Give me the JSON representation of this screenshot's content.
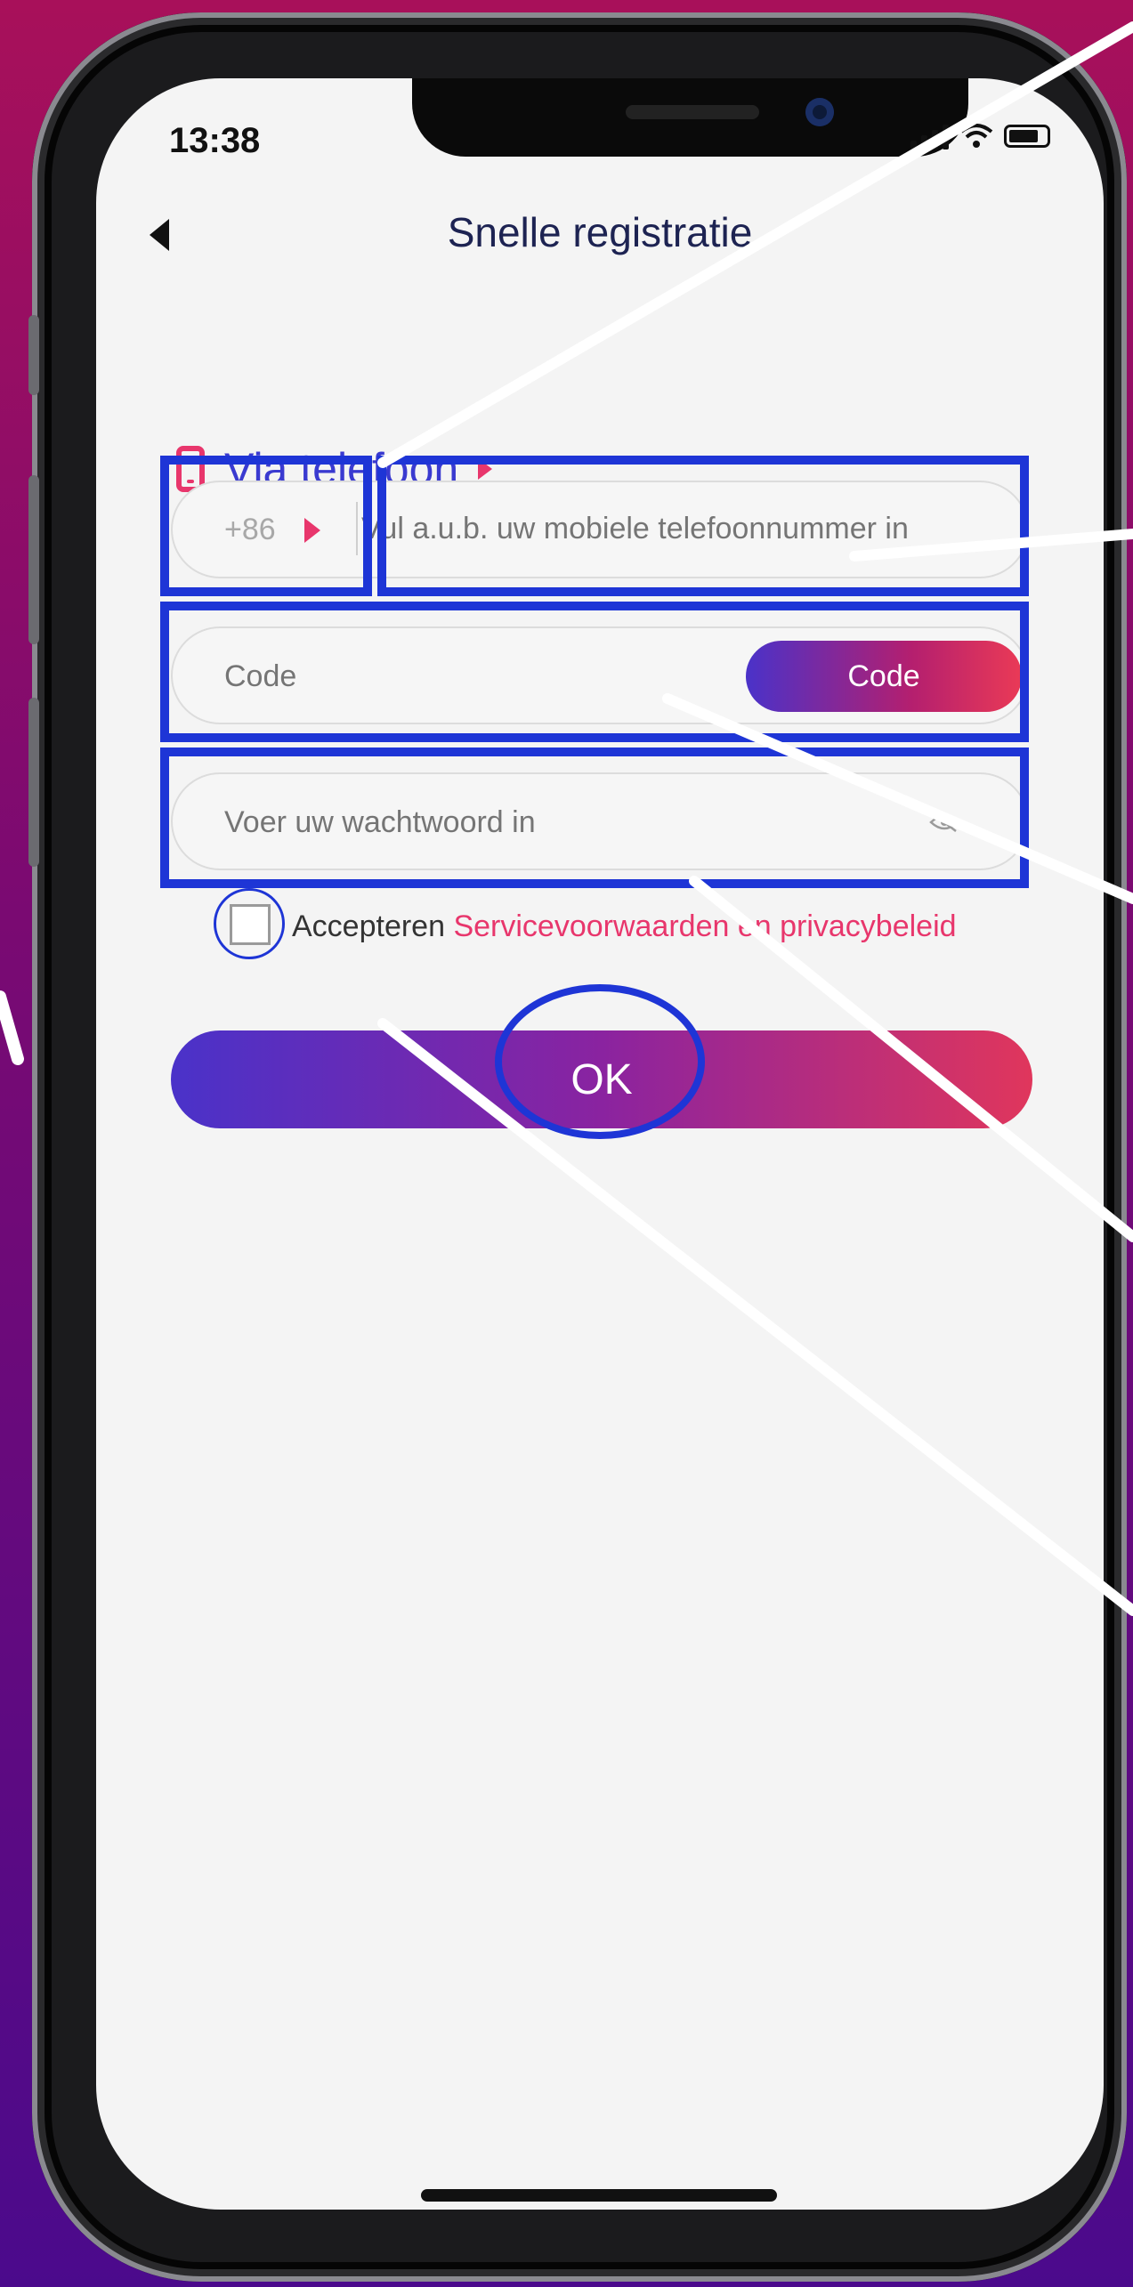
{
  "status_bar": {
    "time": "13:38"
  },
  "header": {
    "title": "Snelle registratie",
    "back_icon": "back-arrow-icon"
  },
  "section": {
    "label": "Via telefoon",
    "icon": "phone-icon"
  },
  "form": {
    "country_code": "+86",
    "phone_placeholder": "Vul a.u.b. uw mobiele telefoonnummer in",
    "code_placeholder": "Code",
    "code_button_label": "Code",
    "password_placeholder": "Voer uw wachtwoord in",
    "accept_label": "Accepteren",
    "terms_link": "Servicevoorwaarden en privacybeleid",
    "submit_label": "OK"
  },
  "colors": {
    "accent_blue": "#3a3ad0",
    "accent_pink": "#e8366c",
    "annotation_blue": "#1e35d6"
  }
}
